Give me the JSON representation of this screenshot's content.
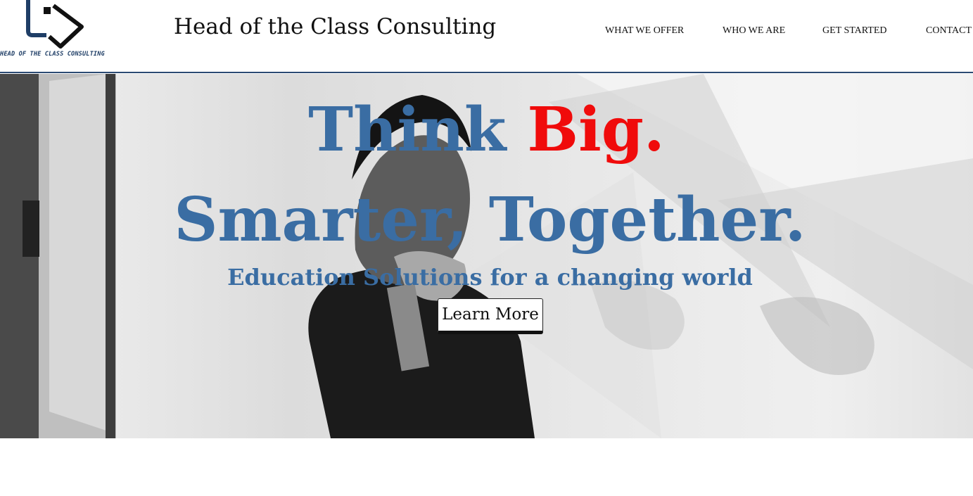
{
  "header": {
    "logo_text": "HEAD OF THE CLASS CONSULTING",
    "brand_title": "Head of the Class Consulting"
  },
  "nav": {
    "items": [
      {
        "label": "WHAT WE OFFER"
      },
      {
        "label": "WHO WE ARE"
      },
      {
        "label": "GET STARTED"
      },
      {
        "label": "CONTACT"
      }
    ]
  },
  "hero": {
    "headline_part1": "Think ",
    "headline_accent": "Big.",
    "headline_line2": "Smarter, Together.",
    "subheadline": "Education Solutions for a changing world",
    "cta_label": "Learn More",
    "background_image": "man-thinking-photo"
  },
  "colors": {
    "primary_blue": "#3a6da3",
    "accent_red": "#f00b0b",
    "header_rule": "#2b4a73",
    "logo_navy": "#1f3e66"
  }
}
